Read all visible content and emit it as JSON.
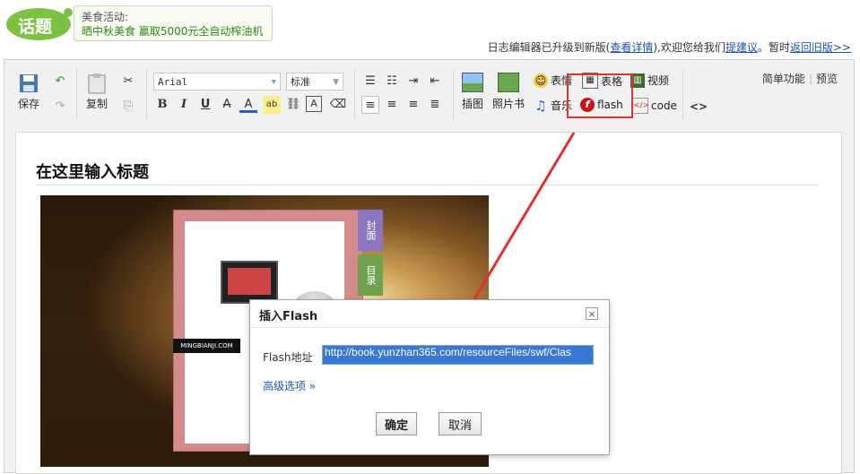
{
  "banner": {
    "logo_text": "话题",
    "promo_line1": "美食活动:",
    "promo_line2": "晒中秋美食 赢取5000元全自动榨油机"
  },
  "notice": {
    "text1": "日志编辑器已升级到新版(",
    "link1": "查看详情",
    "text2": "),欢迎您给我们",
    "link2": "提建议",
    "text3": "。暂时",
    "link3": "返回旧版>>"
  },
  "toolbar": {
    "save_label": "保存",
    "copy_label": "复制",
    "font_family": "Arial",
    "font_size": "标准",
    "insert_image_label": "插图",
    "photo_book_label": "照片书",
    "emoticon_label": "表情",
    "table_label": "表格",
    "video_label": "视频",
    "music_label": "音乐",
    "flash_label": "flash",
    "code_label": "code",
    "source_label": "<>",
    "simple_mode_label": "简单功能",
    "preview_label": "预览"
  },
  "content": {
    "title_placeholder": "在这里输入标题",
    "book_tab1": "封面",
    "book_tab2": "目录",
    "book_site_label": "MINGBIANJI.COM"
  },
  "dialog": {
    "title": "插入Flash",
    "close_glyph": "×",
    "flash_url_label": "Flash地址",
    "flash_url_value": "http://book.yunzhan365.com/resourceFiles/swf/Clas",
    "advanced_label": "高级选项 »",
    "ok_label": "确定",
    "cancel_label": "取消"
  },
  "colors": {
    "highlight": "#e53030",
    "link": "#1a56b8",
    "promo_green": "#2f8a14"
  }
}
